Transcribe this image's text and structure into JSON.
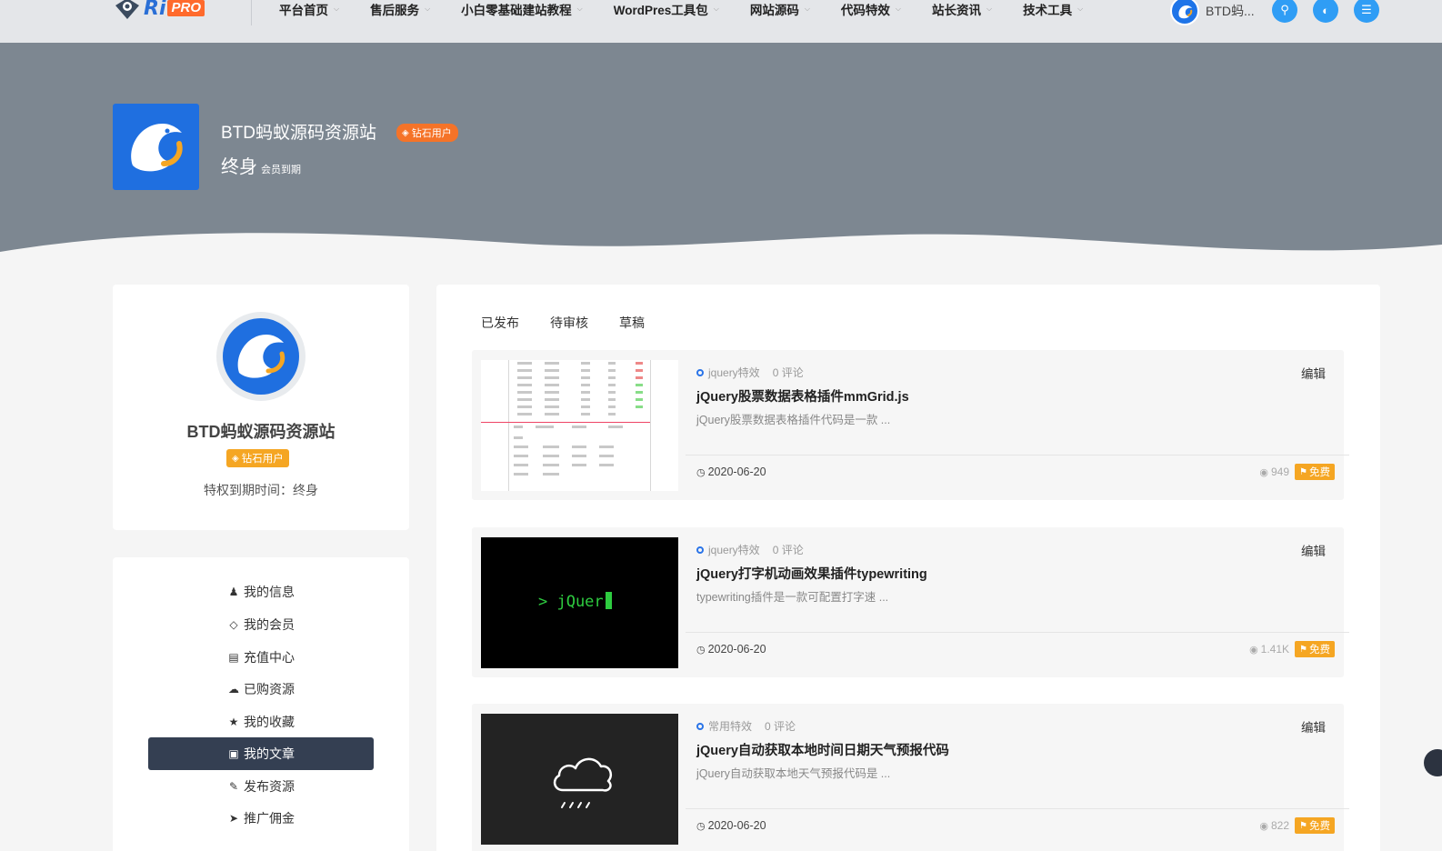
{
  "header": {
    "logo_ri": "Ri",
    "logo_pro": "PRO",
    "nav": [
      {
        "label": "平台首页"
      },
      {
        "label": "售后服务"
      },
      {
        "label": "小白零基础建站教程"
      },
      {
        "label": "WordPres工具包"
      },
      {
        "label": "网站源码"
      },
      {
        "label": "代码特效"
      },
      {
        "label": "站长资讯"
      },
      {
        "label": "技术工具"
      }
    ],
    "user_name": "BTD蚂...",
    "chevron_icon": "chevron-down-icon",
    "icons": [
      "search-icon",
      "theme-toggle-icon",
      "list-menu-icon"
    ]
  },
  "hero": {
    "name": "BTD蚂蚁源码资源站",
    "badge": "钻石用户",
    "expire_big": "终身",
    "expire_small": "会员到期"
  },
  "profile": {
    "name": "BTD蚂蚁源码资源站",
    "badge": "钻石用户",
    "expire": "特权到期时间：终身"
  },
  "menu": [
    {
      "label": "我的信息",
      "icon": "user-icon"
    },
    {
      "label": "我的会员",
      "icon": "diamond-icon"
    },
    {
      "label": "充值中心",
      "icon": "credit-card-icon"
    },
    {
      "label": "已购资源",
      "icon": "cloud-download-icon"
    },
    {
      "label": "我的收藏",
      "icon": "star-icon"
    },
    {
      "label": "我的文章",
      "icon": "file-icon",
      "active": true
    },
    {
      "label": "发布资源",
      "icon": "pencil-icon"
    },
    {
      "label": "推广佣金",
      "icon": "paper-plane-icon"
    }
  ],
  "tabs": [
    {
      "label": "已发布"
    },
    {
      "label": "待审核"
    },
    {
      "label": "草稿"
    }
  ],
  "articles": [
    {
      "category": "jquery特效",
      "comments": "0 评论",
      "edit": "编辑",
      "title": "jQuery股票数据表格插件mmGrid.js",
      "excerpt": "jQuery股票数据表格插件代码是一款 ...",
      "date": "2020-06-20",
      "views": "949",
      "price": "免费",
      "thumb": "table-screenshot"
    },
    {
      "category": "jquery特效",
      "comments": "0 评论",
      "edit": "编辑",
      "title": "jQuery打字机动画效果插件typewriting",
      "excerpt": "typewriting插件是一款可配置打字速 ...",
      "date": "2020-06-20",
      "views": "1.41K",
      "price": "免费",
      "thumb_text": "> jQuer"
    },
    {
      "category": "常用特效",
      "comments": "0 评论",
      "edit": "编辑",
      "title": "jQuery自动获取本地时间日期天气预报代码",
      "excerpt": "jQuery自动获取本地天气预报代码是 ...",
      "date": "2020-06-20",
      "views": "822",
      "price": "免费",
      "thumb": "rain-cloud-icon"
    }
  ],
  "colors": {
    "primary_blue": "#2f9df5",
    "orange": "#f57328",
    "gold": "#f5a623",
    "active_menu": "#343f52",
    "hero_bg": "#7d8791"
  }
}
